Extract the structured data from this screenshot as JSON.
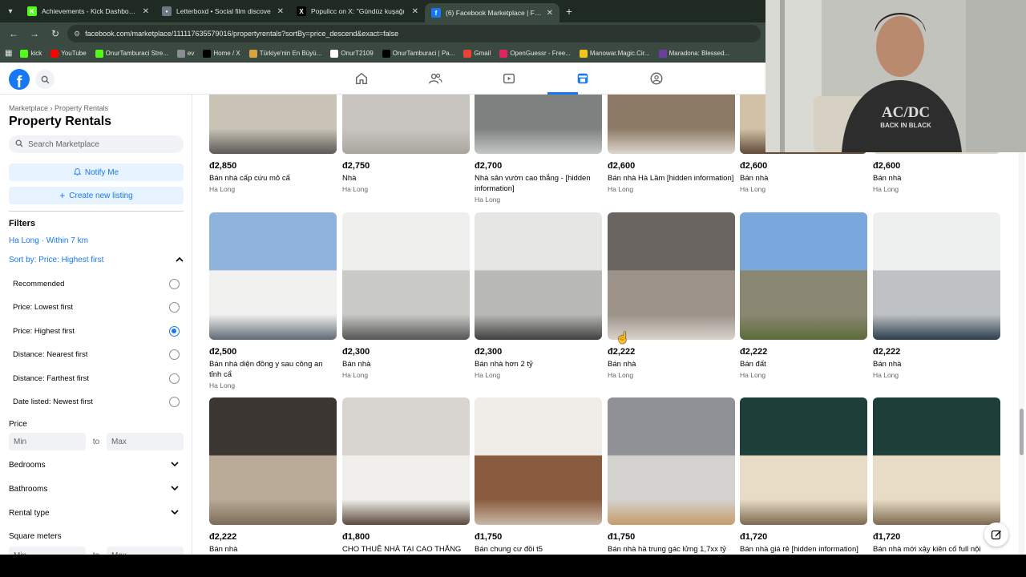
{
  "browser": {
    "tabs": [
      {
        "title": "Achievements - Kick Dashboard",
        "color": "#53fc18",
        "glyph": "K"
      },
      {
        "title": "Letterboxd • Social film discove",
        "color": "#6b7a80",
        "glyph": "•"
      },
      {
        "title": "Populicc on X: \"Gündüz kuşağı",
        "color": "#000000",
        "glyph": "X"
      },
      {
        "title": "(6) Facebook Marketplace | Face",
        "color": "#1877f2",
        "glyph": "f"
      }
    ],
    "url": "facebook.com/marketplace/111117635579016/propertyrentals?sortBy=price_descend&exact=false",
    "bookmarks": [
      {
        "label": "kick",
        "color": "#53fc18"
      },
      {
        "label": "YouTube",
        "color": "#ff0000"
      },
      {
        "label": "OnurTamburaci Stre...",
        "color": "#53fc18"
      },
      {
        "label": "ev",
        "color": "#8a8d91"
      },
      {
        "label": "Home / X",
        "color": "#000000"
      },
      {
        "label": "Türkiye'nin En Büyü...",
        "color": "#d9a43b"
      },
      {
        "label": "OnurT2109",
        "color": "#ffffff"
      },
      {
        "label": "OnurTamburaci | Pa...",
        "color": "#000000"
      },
      {
        "label": "Gmail",
        "color": "#ea4335"
      },
      {
        "label": "OpenGuessr - Free...",
        "color": "#e0245e"
      },
      {
        "label": "Manowar.Magic.Cir...",
        "color": "#f6c21c"
      },
      {
        "label": "Maradona: Blessed...",
        "color": "#6b3fa0"
      }
    ]
  },
  "sidebar": {
    "breadcrumb": "Marketplace › Property Rentals",
    "title": "Property Rentals",
    "search_placeholder": "Search Marketplace",
    "notify_label": "Notify Me",
    "create_label": "Create new listing",
    "filters_heading": "Filters",
    "location": "Ha Long · Within 7 km",
    "sort_label": "Sort by: Price: Highest first",
    "sort_options": [
      {
        "label": "Recommended",
        "checked": false
      },
      {
        "label": "Price: Lowest first",
        "checked": false
      },
      {
        "label": "Price: Highest first",
        "checked": true
      },
      {
        "label": "Distance: Nearest first",
        "checked": false
      },
      {
        "label": "Distance: Farthest first",
        "checked": false
      },
      {
        "label": "Date listed: Newest first",
        "checked": false
      }
    ],
    "price_heading": "Price",
    "min_placeholder": "Min",
    "max_placeholder": "Max",
    "to_label": "to",
    "dropdowns": [
      "Bedrooms",
      "Bathrooms",
      "Rental type",
      "Square meters"
    ]
  },
  "listings": [
    {
      "price": "đ2,850",
      "title": "Bán nhà cấp cứu mỏ cẩ",
      "location": "Ha Long"
    },
    {
      "price": "đ2,750",
      "title": "Nhà",
      "location": "Ha Long"
    },
    {
      "price": "đ2,700",
      "title": "Nhà sân vườn cao thắng - [hidden information]",
      "location": "Ha Long"
    },
    {
      "price": "đ2,600",
      "title": "Bán nhà Hà Lầm [hidden information]",
      "location": "Ha Long"
    },
    {
      "price": "đ2,600",
      "title": "Bán nhà",
      "location": "Ha Long"
    },
    {
      "price": "đ2,600",
      "title": "Bán nhà",
      "location": "Ha Long"
    },
    {
      "price": "đ2,500",
      "title": "Bán nhà diện đông y sau công an tỉnh cẩ",
      "location": "Ha Long"
    },
    {
      "price": "đ2,300",
      "title": "Bán nhà",
      "location": "Ha Long"
    },
    {
      "price": "đ2,300",
      "title": "Bán nhà hơn 2 tỷ",
      "location": "Ha Long"
    },
    {
      "price": "đ2,222",
      "title": "Bán nhà",
      "location": "Ha Long"
    },
    {
      "price": "đ2,222",
      "title": "Bán đất",
      "location": "Ha Long"
    },
    {
      "price": "đ2,222",
      "title": "Bán nhà",
      "location": "Ha Long"
    },
    {
      "price": "đ2,222",
      "title": "Bán nhà",
      "location": ""
    },
    {
      "price": "đ1,800",
      "title": "CHO THUÊ NHÀ TẠI CAO THẮNG",
      "location": ""
    },
    {
      "price": "đ1,750",
      "title": "Bán chung cư đồi t5",
      "location": ""
    },
    {
      "price": "đ1,750",
      "title": "Bán nhà hà trung gác lửng 1,7xx tỷ",
      "location": ""
    },
    {
      "price": "đ1,720",
      "title": "Bán nhà giá rẻ [hidden information]",
      "location": ""
    },
    {
      "price": "đ1,720",
      "title": "Bán nhà mới xây kiên cố full nội",
      "location": ""
    }
  ],
  "overlay": {
    "shirt_line1": "AC/DC",
    "shirt_line2": "BACK IN BLACK"
  }
}
